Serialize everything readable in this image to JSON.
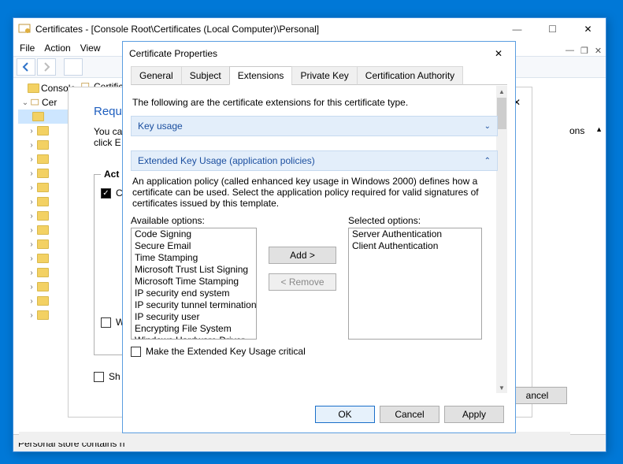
{
  "mainWindow": {
    "title": "Certificates - [Console Root\\Certificates (Local Computer)\\Personal]",
    "menus": [
      "File",
      "Action",
      "View"
    ],
    "statusbar": "Personal store contains n",
    "tree": {
      "root": "Console",
      "node": "Cer",
      "addr": "Certifica"
    },
    "actionsLabel": "ons",
    "scrollArrow": "▲"
  },
  "midDialog": {
    "headerFragment": "Requ",
    "descLine1": "You ca",
    "descLine2": "click E",
    "groupLabel": "Act",
    "checkboxC": "C",
    "checkboxW": "W",
    "checkboxSh": "Sh",
    "cancelBtn": "ancel",
    "closeX": "✕"
  },
  "certProps": {
    "title": "Certificate Properties",
    "tabs": [
      "General",
      "Subject",
      "Extensions",
      "Private Key",
      "Certification Authority"
    ],
    "activeTabIndex": 2,
    "intro": "The following are the certificate extensions for this certificate type.",
    "expander1": "Key usage",
    "expander2": "Extended Key Usage (application policies)",
    "ekuDesc": "An application policy (called enhanced key usage in Windows 2000) defines how a certificate can be used. Select the application policy required for valid signatures of certificates issued by this template.",
    "availableLabel": "Available options:",
    "selectedLabel": "Selected options:",
    "available": [
      "Code Signing",
      "Secure Email",
      "Time Stamping",
      "Microsoft Trust List Signing",
      "Microsoft Time Stamping",
      "IP security end system",
      "IP security tunnel termination",
      "IP security user",
      "Encrypting File System",
      "Windows Hardware Driver"
    ],
    "selected": [
      "Server Authentication",
      "Client Authentication"
    ],
    "addBtn": "Add >",
    "removeBtn": "< Remove",
    "criticalChk": "Make the Extended Key Usage critical",
    "okBtn": "OK",
    "cancelBtn": "Cancel",
    "applyBtn": "Apply"
  }
}
